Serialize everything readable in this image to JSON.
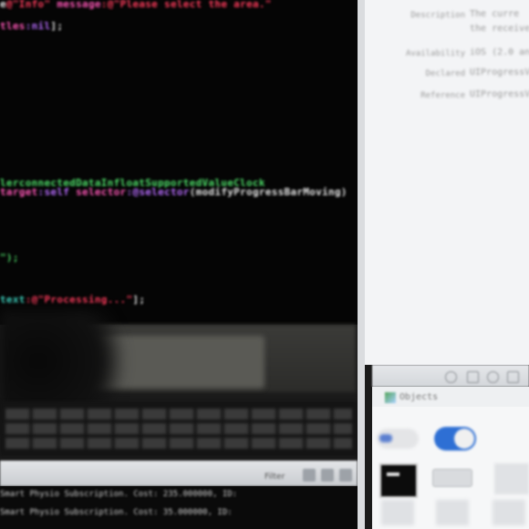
{
  "editor": {
    "lines": [
      {
        "segments": [
          {
            "text": "e",
            "color": "white"
          },
          {
            "text": "@\"Info\"",
            "color": "red"
          },
          {
            "text": " message",
            "color": "pink"
          },
          {
            "text": ":@\"Please select the area.\"",
            "color": "red"
          }
        ]
      },
      {
        "segments": [
          {
            "text": "tles",
            "color": "pink"
          },
          {
            "text": ":nil",
            "color": "purple"
          },
          {
            "text": "];",
            "color": "white"
          }
        ]
      },
      {
        "segments": [
          {
            "text": "lerconnectedDataInfloatSupportedValueClock",
            "color": "green"
          }
        ]
      },
      {
        "segments": [
          {
            "text": "target",
            "color": "pink"
          },
          {
            "text": ":self",
            "color": "purple"
          },
          {
            "text": " selector",
            "color": "pink"
          },
          {
            "text": ":@selector",
            "color": "purple"
          },
          {
            "text": "(modifyProgressBarMoving)",
            "color": "white"
          }
        ]
      },
      {
        "segments": [
          {
            "text": "\");",
            "color": "green"
          }
        ]
      },
      {
        "segments": [
          {
            "text": "text",
            "color": "teal"
          },
          {
            "text": ":@\"Processing...\"",
            "color": "red"
          },
          {
            "text": "];",
            "color": "white"
          }
        ]
      }
    ]
  },
  "debug_bar": {
    "label": "Filter"
  },
  "console": {
    "lines": [
      "Smart Physio Subscription. Cost: 235.000000, ID:",
      "Smart Physio Subscription. Cost: 35.000000, ID:"
    ]
  },
  "inspector": {
    "rows": [
      {
        "key": "Description",
        "value": "The curre"
      },
      {
        "key": "",
        "value": "the receive"
      },
      {
        "key": "Availability",
        "value": "iOS (2.0 an"
      },
      {
        "key": "Declared",
        "value": "UIProgressV"
      },
      {
        "key": "Reference",
        "value": "UIProgressV"
      }
    ]
  },
  "library": {
    "title": "Objects"
  },
  "colors": {
    "editor_bg": "#050505",
    "keyword": "#ff57b8",
    "string": "#ff3b5c",
    "selector": "#b86cff",
    "comment": "#4fe06a",
    "switch_on": "#2e6fd4"
  }
}
